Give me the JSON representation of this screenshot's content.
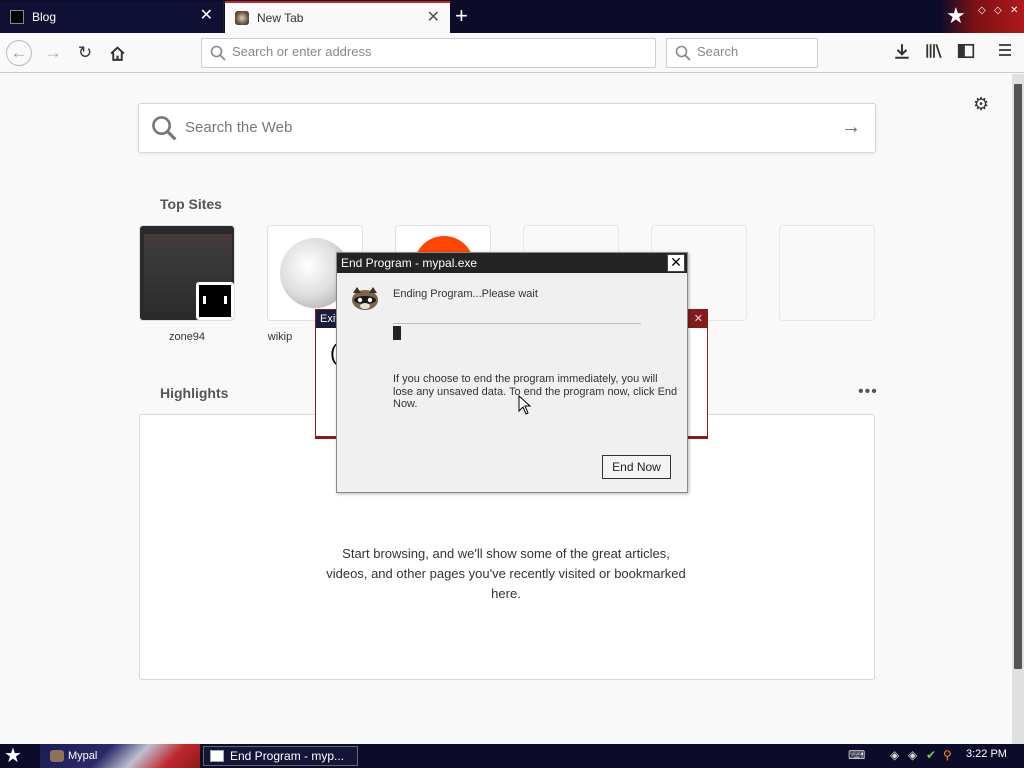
{
  "tabs": [
    {
      "title": "Blog",
      "active": false
    },
    {
      "title": "New Tab",
      "active": true
    }
  ],
  "toolbar": {
    "url_placeholder": "Search or enter address",
    "search_placeholder": "Search"
  },
  "newtab": {
    "web_search_placeholder": "Search the Web",
    "top_sites_title": "Top Sites",
    "top_sites": [
      {
        "label": "zone94"
      },
      {
        "label": "wikip"
      },
      {
        "label": ""
      },
      {
        "label": ""
      },
      {
        "label": ""
      },
      {
        "label": ""
      }
    ],
    "highlights_title": "Highlights",
    "highlights_empty_message": "Start browsing, and we'll show some of the great articles, videos, and other pages you've recently visited or bookmarked here."
  },
  "background_dialog": {
    "title_fragment": "Exit",
    "fragment": "("
  },
  "end_program_dialog": {
    "title": "End Program - mypal.exe",
    "status": "Ending Program...Please wait",
    "message": "If you choose to end the program immediately, you will lose any unsaved data. To end the program now, click End Now.",
    "button": "End Now"
  },
  "taskbar": {
    "items": [
      {
        "label": "Mypal"
      },
      {
        "label": "End Program - myp..."
      }
    ],
    "clock": "3:22 PM"
  },
  "colors": {
    "accent_red": "#c0272d",
    "taskbar_bg": "#0c0c2a",
    "dialog_title_bg": "#242424"
  }
}
